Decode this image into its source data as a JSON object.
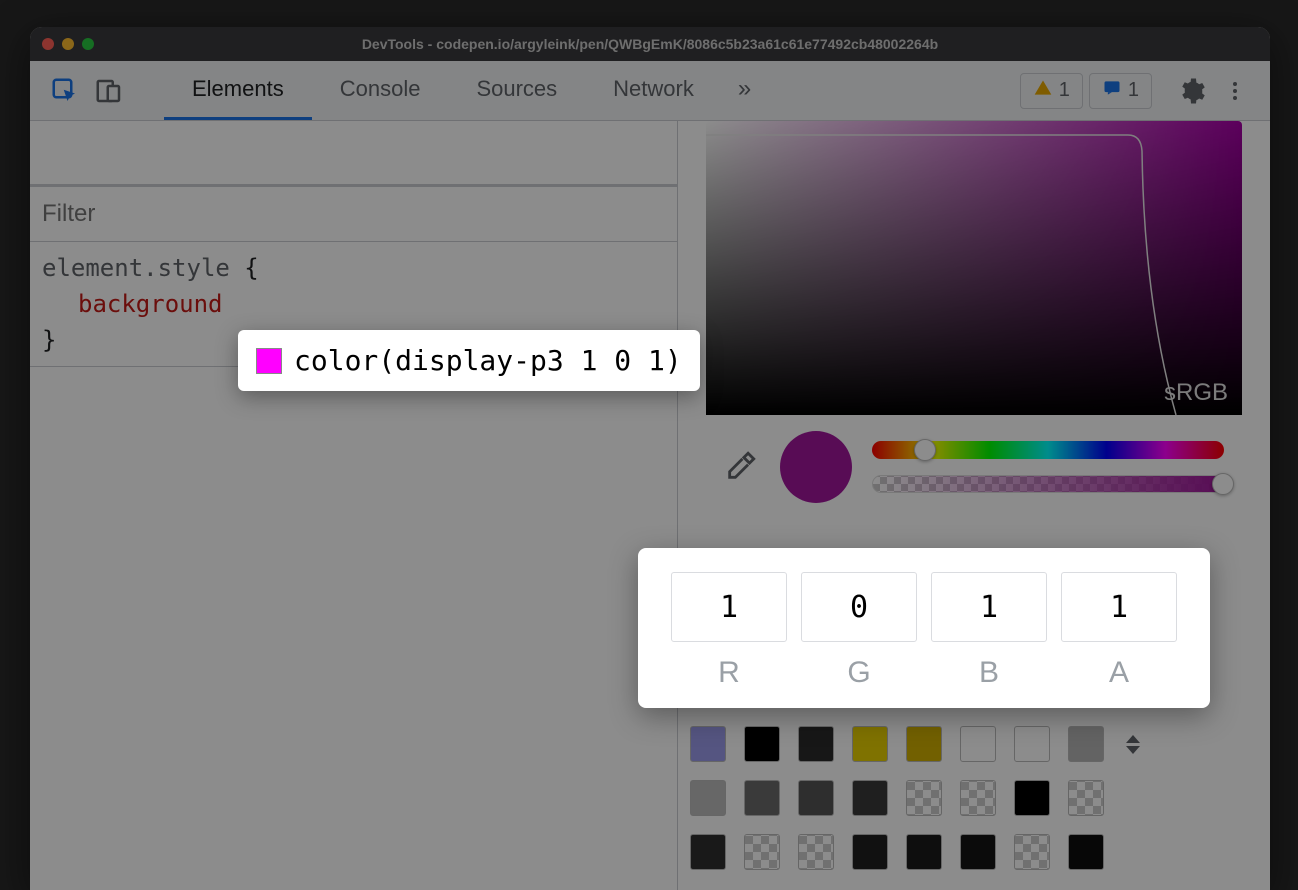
{
  "window": {
    "title": "DevTools - codepen.io/argyleink/pen/QWBgEmK/8086c5b23a61c61e77492cb48002264b"
  },
  "toolbar": {
    "tabs": [
      "Elements",
      "Console",
      "Sources",
      "Network"
    ],
    "active_tab": "Elements",
    "more_glyph": "»",
    "warning_count": "1",
    "message_count": "1"
  },
  "styles": {
    "filter_placeholder": "Filter",
    "selector": "element.style",
    "open_brace": " {",
    "property": "background",
    "close_brace": "}"
  },
  "value_popup": {
    "text": "color(display-p3 1 0 1)",
    "swatch": "#ff00ff"
  },
  "picker": {
    "gamut_label": "sRGB",
    "current_color": "#a0179b",
    "hue_thumb_pct": 15,
    "alpha_thumb_pct": 100
  },
  "rgba": {
    "components": [
      {
        "label": "R",
        "value": "1"
      },
      {
        "label": "G",
        "value": "0"
      },
      {
        "label": "B",
        "value": "1"
      },
      {
        "label": "A",
        "value": "1"
      }
    ]
  },
  "palette": {
    "rows": [
      [
        "#9c9cec",
        "#000000",
        "#2b2b2b",
        "#e8d000",
        "#d0b000",
        "#ffffff",
        "#ffffff",
        "#b5b5b5"
      ],
      [
        "#bcbcbc",
        "#6a6a6a",
        "#555555",
        "#3a3a3a",
        "checker",
        "checker",
        "#000000",
        "checker"
      ],
      [
        "#2f2f2f",
        "checker",
        "checker",
        "#1f1f1f",
        "#1a1a1a",
        "#151515",
        "checker",
        "#0d0d0d"
      ]
    ]
  }
}
